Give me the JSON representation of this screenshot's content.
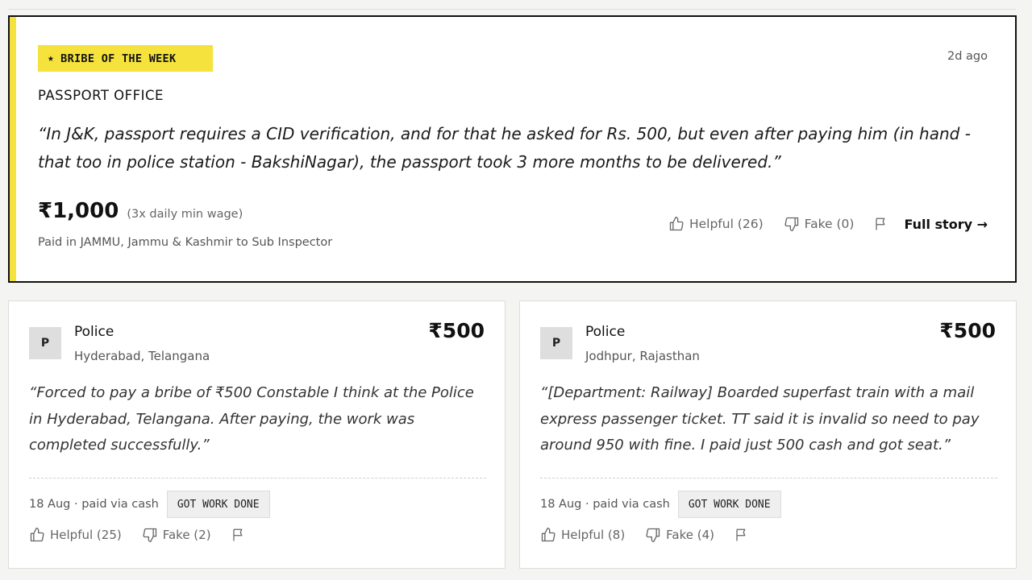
{
  "featured": {
    "badge": "BRIBE OF THE WEEK",
    "badge_icon": "star-icon",
    "time_ago": "2d ago",
    "category": "PASSPORT OFFICE",
    "quote": "“In J&K, passport requires a CID verification, and for that he asked for Rs. 500, but even after paying him (in hand - that too in police station - BakshiNagar), the passport took 3 more months to be delivered.”",
    "amount": "₹1,000",
    "wage_note": "(3x daily min wage)",
    "paid_in": "Paid in JAMMU, Jammu & Kashmir to Sub Inspector",
    "helpful": "Helpful (26)",
    "fake": "Fake (0)",
    "full_story": "Full story →",
    "accent_color": "#f5e23c"
  },
  "cards": [
    {
      "avatar": "P",
      "department": "Police",
      "location": "Hyderabad, Telangana",
      "amount": "₹500",
      "quote": "“Forced to pay a bribe of ₹500 Constable I think at the Police in Hyderabad, Telangana. After paying, the work was completed successfully.”",
      "meta": "18 Aug · paid via cash",
      "status": "GOT WORK DONE",
      "helpful": "Helpful (25)",
      "fake": "Fake (2)"
    },
    {
      "avatar": "P",
      "department": "Police",
      "location": "Jodhpur, Rajasthan",
      "amount": "₹500",
      "quote": "“[Department: Railway] Boarded superfast train with a mail express passenger ticket. TT said it is invalid so need to pay around 950 with fine. I paid just 500 cash and got seat.”",
      "meta": "18 Aug · paid via cash",
      "status": "GOT WORK DONE",
      "helpful": "Helpful (8)",
      "fake": "Fake (4)"
    }
  ]
}
